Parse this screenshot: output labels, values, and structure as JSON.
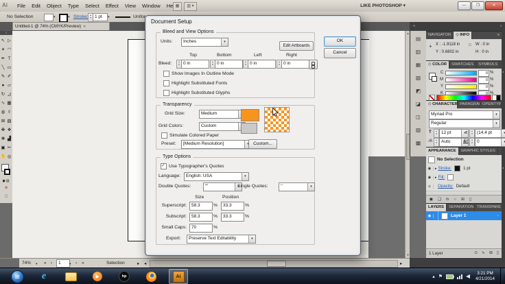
{
  "window": {
    "app_logo": "Ai",
    "workspace": "LIKE PHOTOSHOP",
    "minimize": "—",
    "restore": "❐",
    "close": "✕"
  },
  "menu": {
    "items": [
      "File",
      "Edit",
      "Object",
      "Type",
      "Select",
      "Effect",
      "View",
      "Window",
      "Help"
    ]
  },
  "control_bar": {
    "selection_status": "No Selection",
    "stroke_label": "Stroke:",
    "stroke_width": "1 pt",
    "profile": "Unifor"
  },
  "document_tab": {
    "title": "Untitled-1 @ 74% (CMYK/Preview)"
  },
  "toolbar": {
    "tools": [
      {
        "name": "selection",
        "glyph": "↖"
      },
      {
        "name": "direct-selection",
        "glyph": "▷"
      },
      {
        "name": "magic-wand",
        "glyph": "✶"
      },
      {
        "name": "lasso",
        "glyph": "◠"
      },
      {
        "name": "pen",
        "glyph": "✒"
      },
      {
        "name": "type",
        "glyph": "T"
      },
      {
        "name": "line-segment",
        "glyph": "╲"
      },
      {
        "name": "rectangle",
        "glyph": "▭"
      },
      {
        "name": "paintbrush",
        "glyph": "✎"
      },
      {
        "name": "pencil",
        "glyph": "✐"
      },
      {
        "name": "blob-brush",
        "glyph": "●"
      },
      {
        "name": "eraser",
        "glyph": "▱"
      },
      {
        "name": "rotate",
        "glyph": "↻"
      },
      {
        "name": "scale",
        "glyph": "◿"
      },
      {
        "name": "width",
        "glyph": "∿"
      },
      {
        "name": "free-transform",
        "glyph": "▦"
      },
      {
        "name": "shape-builder",
        "glyph": "◍"
      },
      {
        "name": "perspective-grid",
        "glyph": "◊"
      },
      {
        "name": "mesh",
        "glyph": "⊞"
      },
      {
        "name": "gradient",
        "glyph": "▧"
      },
      {
        "name": "eyedropper",
        "glyph": "✤"
      },
      {
        "name": "blend",
        "glyph": "❖"
      },
      {
        "name": "symbol-sprayer",
        "glyph": "❃"
      },
      {
        "name": "column-graph",
        "glyph": "▟"
      },
      {
        "name": "artboard",
        "glyph": "▣"
      },
      {
        "name": "slice",
        "glyph": "✂"
      },
      {
        "name": "hand",
        "glyph": "✋"
      },
      {
        "name": "zoom",
        "glyph": "◎"
      }
    ]
  },
  "dock": {
    "icons": [
      "▤",
      "▥",
      "▦",
      "▧",
      "◩",
      "◪",
      "◫",
      "▨",
      "▩"
    ]
  },
  "dialog": {
    "title": "Document Setup",
    "ok": "OK",
    "cancel": "Cancel",
    "bleed": {
      "legend": "Bleed and View Options",
      "units_label": "Units:",
      "units_value": "Inches",
      "edit_artboards": "Edit Artboards",
      "col_top": "Top",
      "col_bottom": "Bottom",
      "col_left": "Left",
      "col_right": "Right",
      "row_label": "Bleed:",
      "values": [
        "0 in",
        "0 in",
        "0 in",
        "0 in"
      ],
      "cb_outline": "Show Images In Outline Mode",
      "cb_fonts": "Highlight Substituted Fonts",
      "cb_glyphs": "Highlight Substituted Glyphs"
    },
    "transparency": {
      "legend": "Transparency",
      "grid_size_label": "Grid Size:",
      "grid_size_value": "Medium",
      "grid_colors_label": "Grid Colors:",
      "grid_colors_value": "Custom",
      "simulate_label": "Simulate Colored Paper",
      "preset_label": "Preset:",
      "preset_value": "[Medium Resolution]",
      "custom_button": "Custom..."
    },
    "type": {
      "legend": "Type Options",
      "quotes_label": "Use Typographer's Quotes",
      "language_label": "Language:",
      "language_value": "English: USA",
      "double_label": "Double Quotes:",
      "double_value": "“”",
      "single_label": "Single Quotes:",
      "single_value": "‘’",
      "size_header": "Size",
      "position_header": "Position",
      "superscript_label": "Superscript:",
      "superscript_size": "58.3",
      "superscript_position": "33.3",
      "subscript_label": "Subscript:",
      "subscript_size": "58.3",
      "subscript_position": "33.3",
      "smallcaps_label": "Small Caps:",
      "smallcaps_size": "70",
      "percent": "%",
      "export_label": "Export:",
      "export_value": "Preserve Text Editability"
    }
  },
  "panels": {
    "info": {
      "tab_navigator": "NAVIGATOR",
      "tab_info": "INFO",
      "x_label": "X :",
      "x_value": "-1.9118 in",
      "y_label": "Y :",
      "y_value": "0.6802 in",
      "w_label": "W :",
      "w_value": "0 in",
      "h_label": "H :",
      "h_value": "0 in"
    },
    "color": {
      "tab_color": "COLOR",
      "tab_swatches": "SWATCHES",
      "tab_symbols": "SYMBOLS",
      "channels": [
        {
          "name": "C",
          "value": "0"
        },
        {
          "name": "M",
          "value": "0"
        },
        {
          "name": "Y",
          "value": "0"
        },
        {
          "name": "K",
          "value": "0"
        }
      ],
      "unit": "%"
    },
    "character": {
      "tab_character": "CHARACTER",
      "tab_paragraph": "PARAGRAPH",
      "tab_opentype": "OPENTYPE",
      "font": "Myriad Pro",
      "style": "Regular",
      "size": "12 pt",
      "leading": "(14.4 pt",
      "kerning": "Auto",
      "tracking": "0"
    },
    "appearance": {
      "tab_appearance": "APPEARANCE",
      "tab_graphic_styles": "GRAPHIC STYLES",
      "selection": "No Selection",
      "stroke_label": "Stroke:",
      "stroke_value": "1 pt",
      "fill_label": "Fill:",
      "opacity_label": "Opacity:",
      "opacity_value": "Default"
    },
    "layers": {
      "tab_layers": "LAYERS",
      "tab_separations": "SEPARATIONS",
      "tab_transparency": "TRANSPARENCY",
      "layer_name": "Layer 1",
      "status": "1 Layer"
    }
  },
  "status_bar": {
    "zoom": "74%",
    "artboard": "1",
    "selection": "Selection"
  },
  "taskbar": {
    "apps": [
      {
        "name": "start",
        "glyph": "⊞"
      },
      {
        "name": "ie",
        "glyph": "e"
      },
      {
        "name": "explorer",
        "glyph": ""
      },
      {
        "name": "media-player",
        "glyph": "▶"
      },
      {
        "name": "hp",
        "glyph": "hp"
      },
      {
        "name": "firefox",
        "glyph": ""
      },
      {
        "name": "illustrator",
        "glyph": "Ai"
      }
    ],
    "time": "3:21 PM",
    "date": "4/21/2014"
  },
  "glyphs": {
    "caret": "▾",
    "plus": "+",
    "wh": "□",
    "diamond": "◇",
    "bridge": "▦",
    "arrange": "▥",
    "tab_close": "✕",
    "eye": "◉",
    "expand": "▸",
    "target": "◦",
    "fx": "fx",
    "solid_square": "◼",
    "hollow_square": "❑",
    "circle": "○",
    "new_item": "⊞",
    "trash": "▯",
    "clip": "⊙",
    "sublayer": "↳",
    "nav_first": "«",
    "nav_prev": "‹",
    "nav_next": "›",
    "nav_last": "»",
    "arrow_right": "▸",
    "arrow_left": "◂",
    "collapse_left": "«",
    "collapse_right": "»",
    "size_icon": "T",
    "leading_icon": "⇕",
    "kerning_icon": "⁄A",
    "tracking_icon": "AV",
    "tray_expand": "▴",
    "flag": "⚑",
    "menu_icon": "≡",
    "none": "⊘",
    "gradient_btn": "▨",
    "screen_mode": "▢"
  },
  "colors": {
    "transparency_orange": "#F7941D",
    "grid_gray": "#C9C9C9",
    "selection_blue": "#2E8BE6"
  }
}
